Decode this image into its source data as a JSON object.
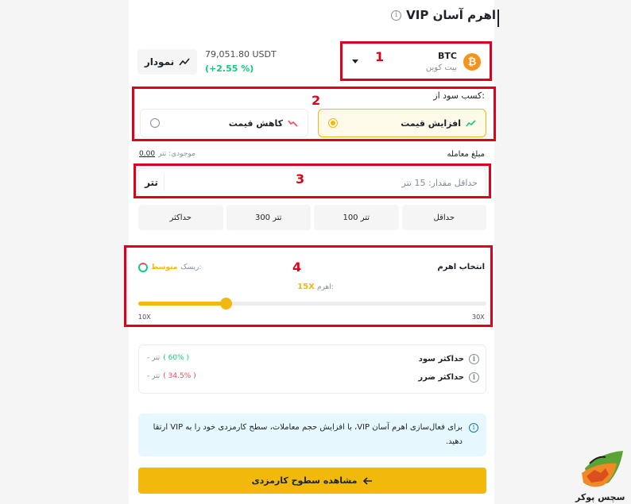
{
  "header": {
    "title": "اهرم آسان VIP",
    "info_icon": "info-icon"
  },
  "asset": {
    "symbol": "BTC",
    "name": "بیت کوین",
    "logo_glyph": "₿",
    "logo_color": "#f7931a"
  },
  "market": {
    "price": "79,051.80 USDT",
    "change": "(+2.55 %)"
  },
  "chart_button": {
    "label": "نمودار"
  },
  "direction": {
    "label": "کسب سود از:",
    "options": [
      {
        "label": "افزایش قیمت",
        "selected": true
      },
      {
        "label": "کاهش قیمت",
        "selected": false
      }
    ]
  },
  "amount": {
    "label": "مبلغ معامله",
    "balance_label": "موجودی: تتر",
    "balance_value": "0.00",
    "placeholder": "حداقل مقدار: 15 تتر",
    "unit": "تتر",
    "quick": [
      "حداقل",
      "100 تتر",
      "300 تتر",
      "حداکثر"
    ]
  },
  "leverage": {
    "label": "انتخاب اهرم",
    "risk_label": "ریسک:",
    "risk_value": "متوسط",
    "value_label": "اهرم:",
    "value": "15X",
    "min_label": "10X",
    "max_label": "30X",
    "min": 10,
    "max": 30,
    "current": 15
  },
  "summary": {
    "max_profit_label": "حداکثر سود",
    "max_profit_amount": "- تتر",
    "max_profit_pct": "( 60% )",
    "max_loss_label": "حداکثر ضرر",
    "max_loss_amount": "- تتر",
    "max_loss_pct": "( 34.5% )"
  },
  "notice": {
    "text": "برای فعال‌سازی اهرم آسان VIP، با افزایش حجم معاملات، سطح کارمزدی خود را به VIP ارتقا دهید."
  },
  "cta": {
    "label": "مشاهده سطوح کارمزدی"
  },
  "annotations": [
    "1",
    "2",
    "3",
    "4"
  ],
  "watermark": {
    "text": "سچس پوکر"
  },
  "colors": {
    "accent": "#f0b90b",
    "positive": "#0ecb81",
    "negative": "#f6465d",
    "highlight": "#e0001b"
  }
}
